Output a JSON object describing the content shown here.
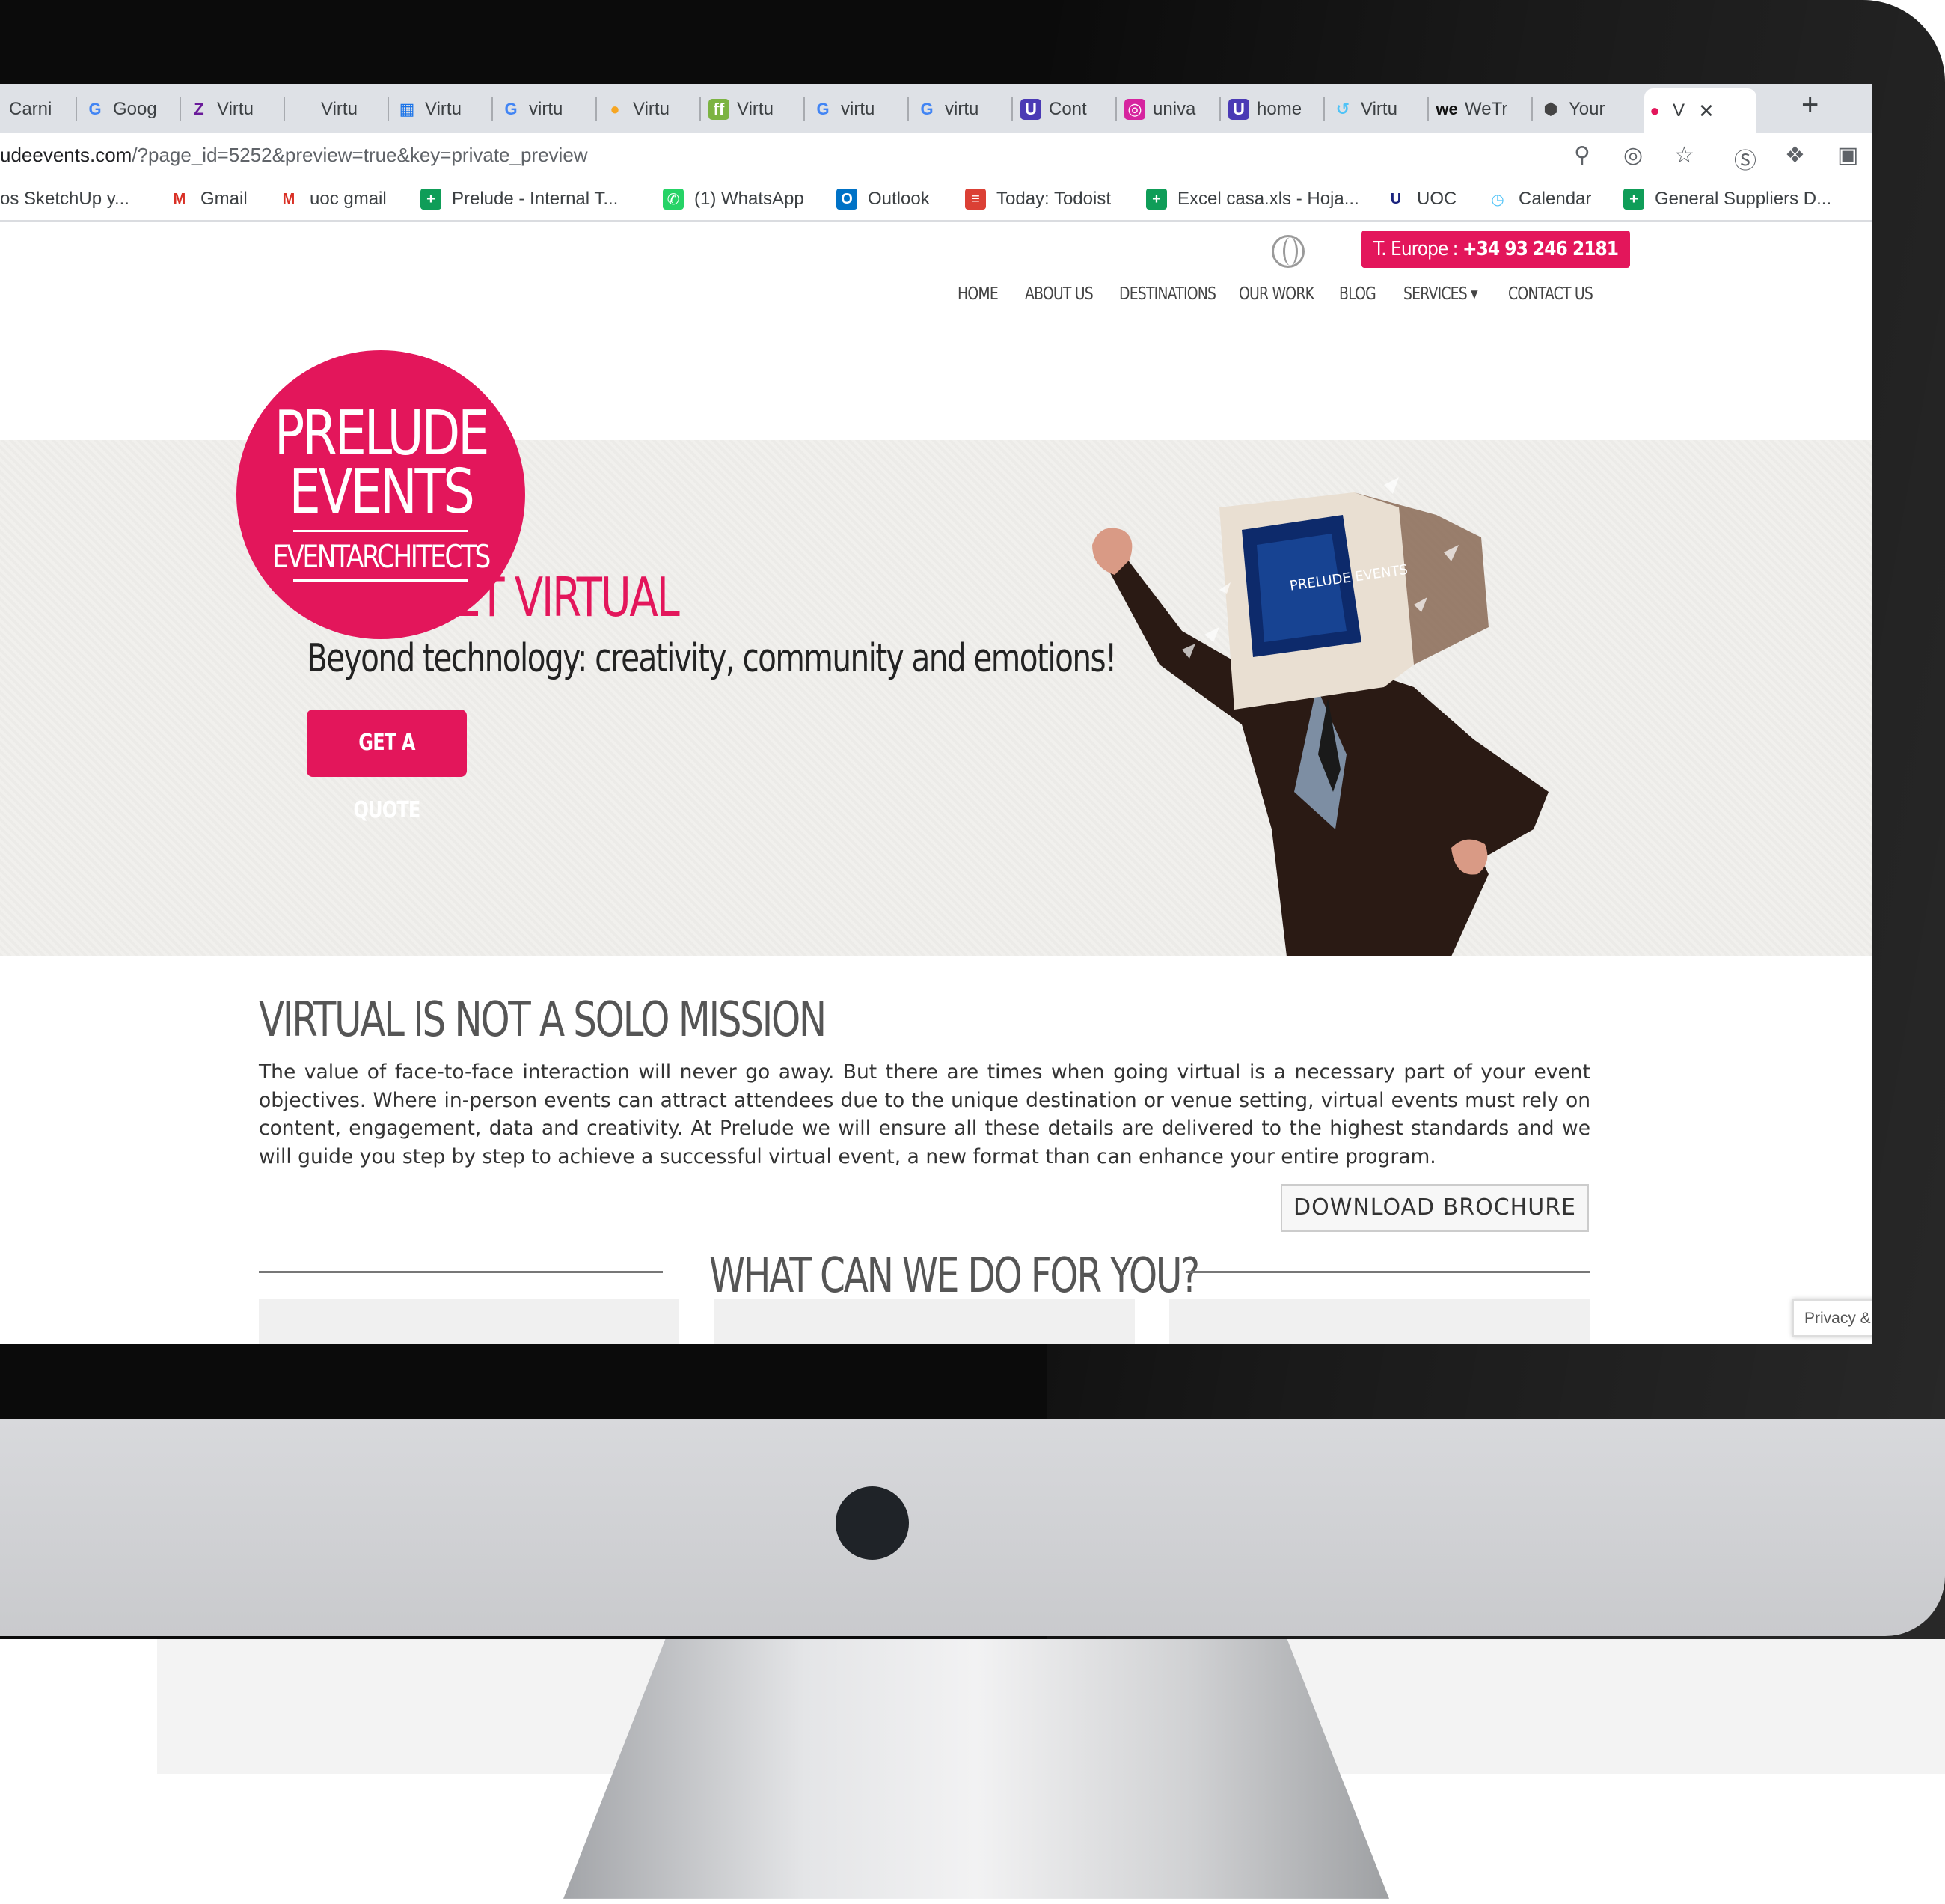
{
  "browser": {
    "tabs": [
      {
        "label": "Carni",
        "icon": "red-square-icon"
      },
      {
        "label": "Goog",
        "icon": "google-icon"
      },
      {
        "label": "Virtu",
        "icon": "zoho-icon"
      },
      {
        "label": "Virtu",
        "icon": "blank-icon"
      },
      {
        "label": "Virtu",
        "icon": "calendar-icon"
      },
      {
        "label": "virtu",
        "icon": "google-icon"
      },
      {
        "label": "Virtu",
        "icon": "colorful-blob-icon"
      },
      {
        "label": "Virtu",
        "icon": "ff-icon"
      },
      {
        "label": "virtu",
        "icon": "google-icon"
      },
      {
        "label": "virtu",
        "icon": "google-icon"
      },
      {
        "label": "Cont",
        "icon": "purple-u-icon"
      },
      {
        "label": "univa",
        "icon": "instagram-icon"
      },
      {
        "label": "home",
        "icon": "purple-u-icon"
      },
      {
        "label": "Virtu",
        "icon": "swirl-icon"
      },
      {
        "label": "WeTr",
        "icon": "we-icon"
      },
      {
        "label": "Your",
        "icon": "cube-icon"
      },
      {
        "label": "V",
        "icon": "prelude-icon",
        "active": true
      }
    ],
    "new_tab": "+",
    "close_tab": "✕",
    "url_host": "udeevents.com",
    "url_rest": "/?page_id=5252&preview=true&key=private_preview",
    "bookmarks": [
      {
        "label": "os SketchUp y...",
        "icon": "none"
      },
      {
        "label": "Gmail",
        "icon": "gmail-icon"
      },
      {
        "label": "uoc gmail",
        "icon": "gmail-icon"
      },
      {
        "label": "Prelude - Internal T...",
        "icon": "sheets-icon"
      },
      {
        "label": "(1) WhatsApp",
        "icon": "whatsapp-icon"
      },
      {
        "label": "Outlook",
        "icon": "outlook-icon"
      },
      {
        "label": "Today: Todoist",
        "icon": "todoist-icon"
      },
      {
        "label": "Excel casa.xls - Hoja...",
        "icon": "sheets-icon"
      },
      {
        "label": "UOC",
        "icon": "uoc-icon"
      },
      {
        "label": "Calendar",
        "icon": "calendar-icon"
      },
      {
        "label": "General Suppliers D...",
        "icon": "sheets-icon"
      }
    ]
  },
  "site": {
    "phone_prefix": "T. Europe : ",
    "phone_number": "+34 93 246 2181",
    "nav": [
      "HOME",
      "ABOUT US",
      "DESTINATIONS",
      "OUR WORK",
      "BLOG",
      "SERVICES",
      "CONTACT US"
    ],
    "logo": {
      "line1": "PRELUDE",
      "line2": "EVENTS",
      "line3": "EVENTARCHITECTS"
    },
    "hero_title": "LET'S GET VIRTUAL",
    "hero_subtitle": "Beyond technology: creativity, community and emotions!",
    "quote_button": "GET A QUOTE",
    "monitor_text": "PRELUDE EVENTS",
    "section_title": "VIRTUAL IS NOT A SOLO MISSION",
    "section_text": "The value of face-to-face interaction will never go away. But there are times when going virtual is a necessary part of your event objectives. Where in-person events can attract attendees due to the unique destination or venue setting, virtual events must rely on content, engagement, data and creativity. At Prelude we will ensure all these details are delivered to the highest standards and we will guide you step by step to achieve a successful virtual event, a new format than can enhance your entire program.",
    "brochure_button": "DOWNLOAD BROCHURE",
    "what_title": "WHAT CAN WE DO FOR YOU?",
    "privacy": "Privacy &"
  },
  "colors": {
    "brand": "#e3165b",
    "bezel": "#0b0b0b",
    "aluminium": "#cfd0d3"
  }
}
